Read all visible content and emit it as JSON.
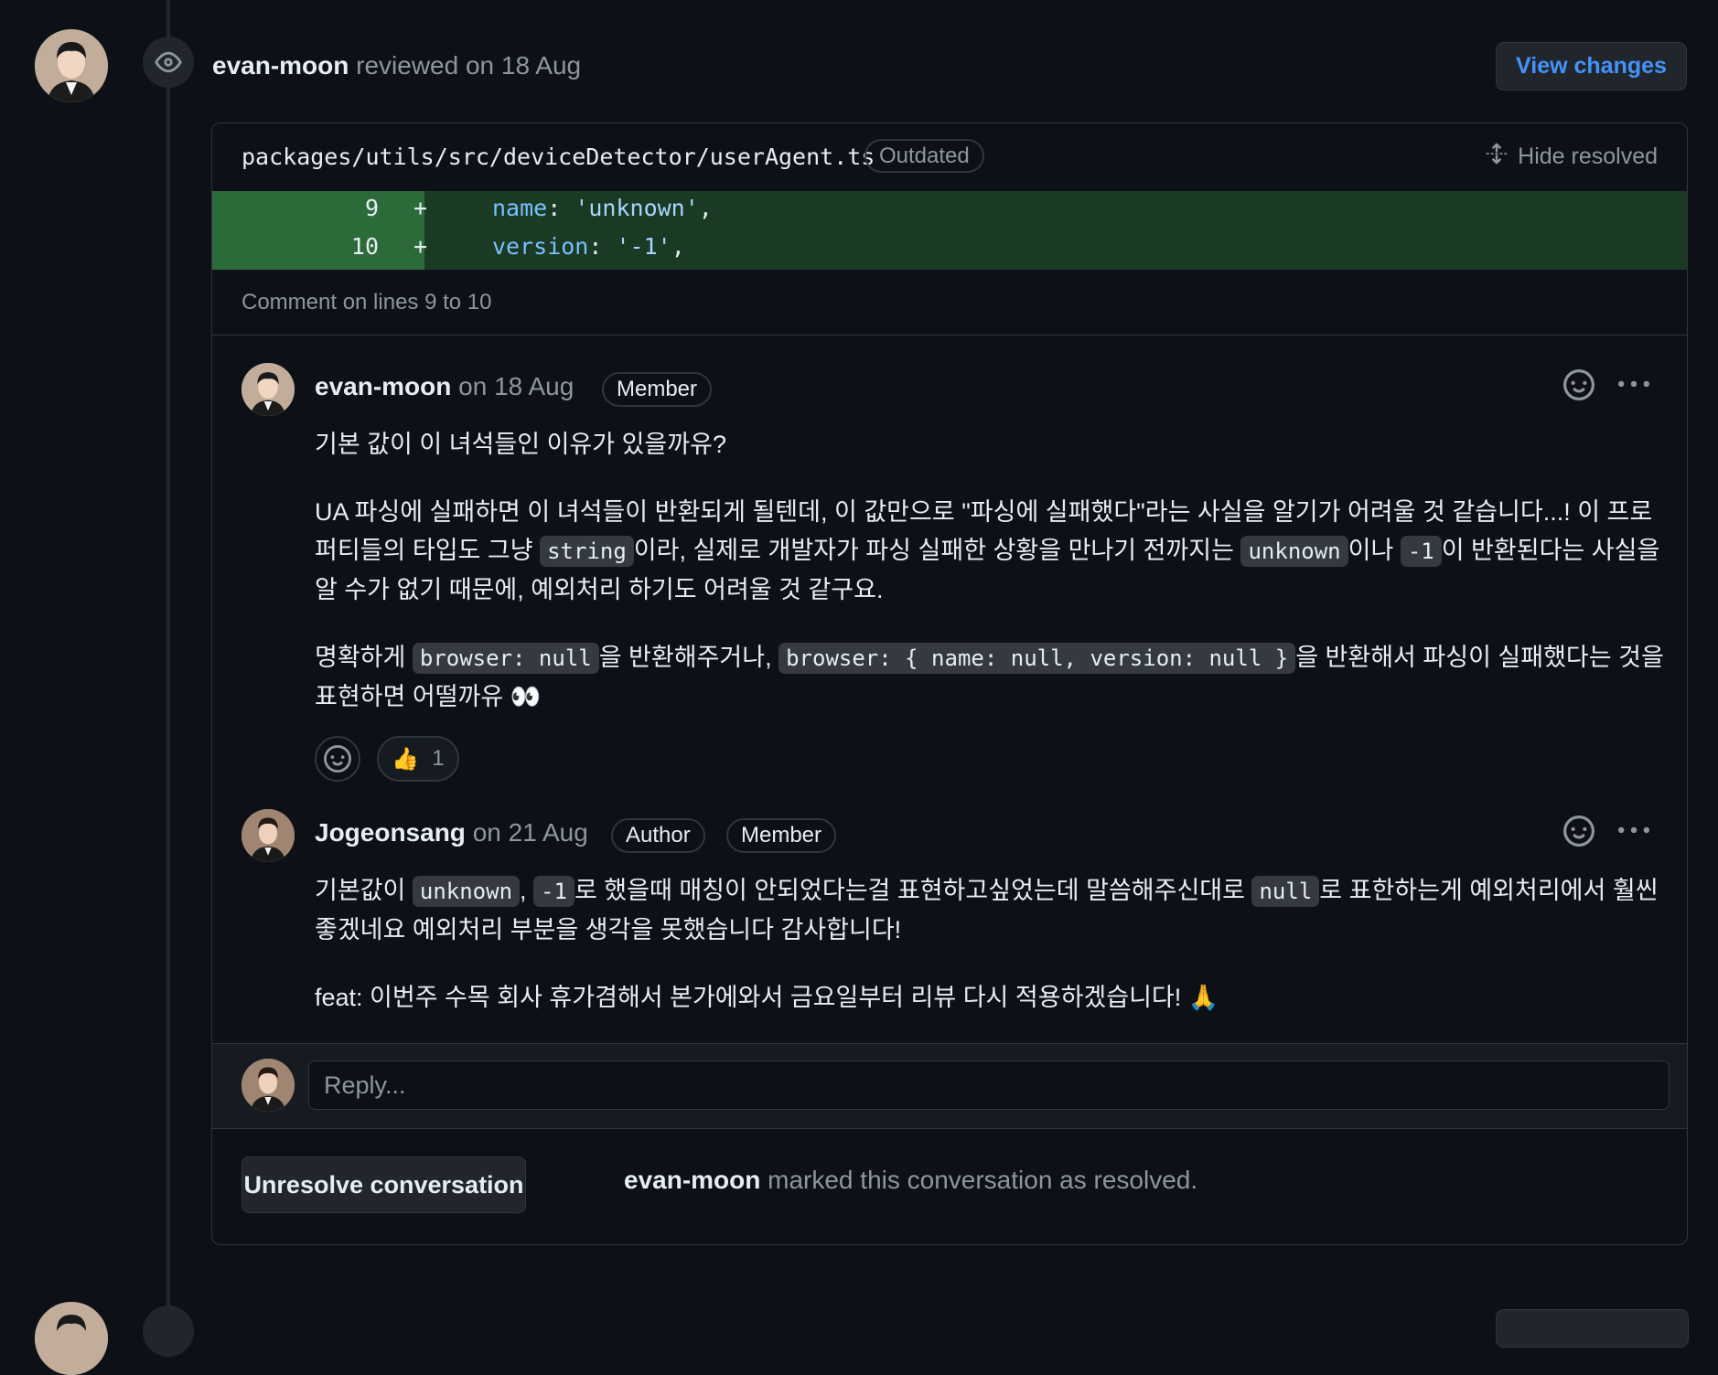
{
  "review": {
    "reviewer": "evan-moon",
    "action": "reviewed on 18 Aug",
    "view_changes_label": "View changes"
  },
  "file": {
    "path": "packages/utils/src/deviceDetector/userAgent.ts",
    "status_badge": "Outdated",
    "hide_resolved_label": "Hide resolved"
  },
  "diff": {
    "lines": [
      {
        "num": "9",
        "sign": "+",
        "key": "name",
        "colon": ": ",
        "value": "'unknown'",
        "tail": ","
      },
      {
        "num": "10",
        "sign": "+",
        "key": "version",
        "colon": ": ",
        "value": "'-1'",
        "tail": ","
      }
    ]
  },
  "comment_on": "Comment on lines 9 to 10",
  "comments": [
    {
      "author": "evan-moon",
      "date": "on 18 Aug",
      "badges": [
        "Member"
      ],
      "body": {
        "p1": "기본 값이 이 녀석들인 이유가 있을까유?",
        "p2a": "UA 파싱에 실패하면 이 녀석들이 반환되게 될텐데, 이 값만으로 \"파싱에 실패했다\"라는 사실을 알기가 어려울 것 같습니다...! 이 프로퍼티들의 타입도 그냥 ",
        "p2_code1": "string",
        "p2b": "이라, 실제로 개발자가 파싱 실패한 상황을 만나기 전까지는 ",
        "p2_code2": "unknown",
        "p2c": "이나 ",
        "p2_code3": "-1",
        "p2d": "이 반환된다는 사실을 알 수가 없기 때문에, 예외처리 하기도 어려울 것 같구요.",
        "p3a": "명확하게 ",
        "p3_code1": "browser: null",
        "p3b": "을 반환해주거나, ",
        "p3_code2": "browser: { name: null, version: null }",
        "p3c": "을 반환해서 파싱이 실패했다는 것을 표현하면 어떨까유 👀"
      },
      "reactions": [
        {
          "emoji": "👍",
          "count": "1"
        }
      ]
    },
    {
      "author": "Jogeonsang",
      "date": "on 21 Aug",
      "badges": [
        "Author",
        "Member"
      ],
      "body": {
        "p1a": "기본값이 ",
        "p1_code1": "unknown",
        "p1b": ", ",
        "p1_code2": "-1",
        "p1c": "로 했을때 매칭이 안되었다는걸 표현하고싶었는데 말씀해주신대로 ",
        "p1_code3": "null",
        "p1d": "로 표한하는게 예외처리에서 훨씬 좋겠네요 예외처리 부분을 생각을 못했습니다 감사합니다!",
        "p2": "feat: 이번주 수목 회사 휴가겸해서 본가에와서 금요일부터 리뷰 다시 적용하겠습니다! 🙏"
      }
    }
  ],
  "reply": {
    "placeholder": "Reply..."
  },
  "footer": {
    "unresolve_label": "Unresolve conversation",
    "resolved_by": "evan-moon",
    "resolved_text": " marked this conversation as resolved."
  },
  "icons": {
    "eye": "eye-icon",
    "hide_resolved": "unfold-icon",
    "smiley": "smiley-icon",
    "kebab": "kebab-horizontal-icon"
  },
  "colors": {
    "background": "#0d1117",
    "border": "#30363d",
    "accent_link": "#4493f8",
    "diff_added": "#1b3a24",
    "diff_gutter": "#2d6a3a",
    "muted_text": "#8d96a0"
  }
}
